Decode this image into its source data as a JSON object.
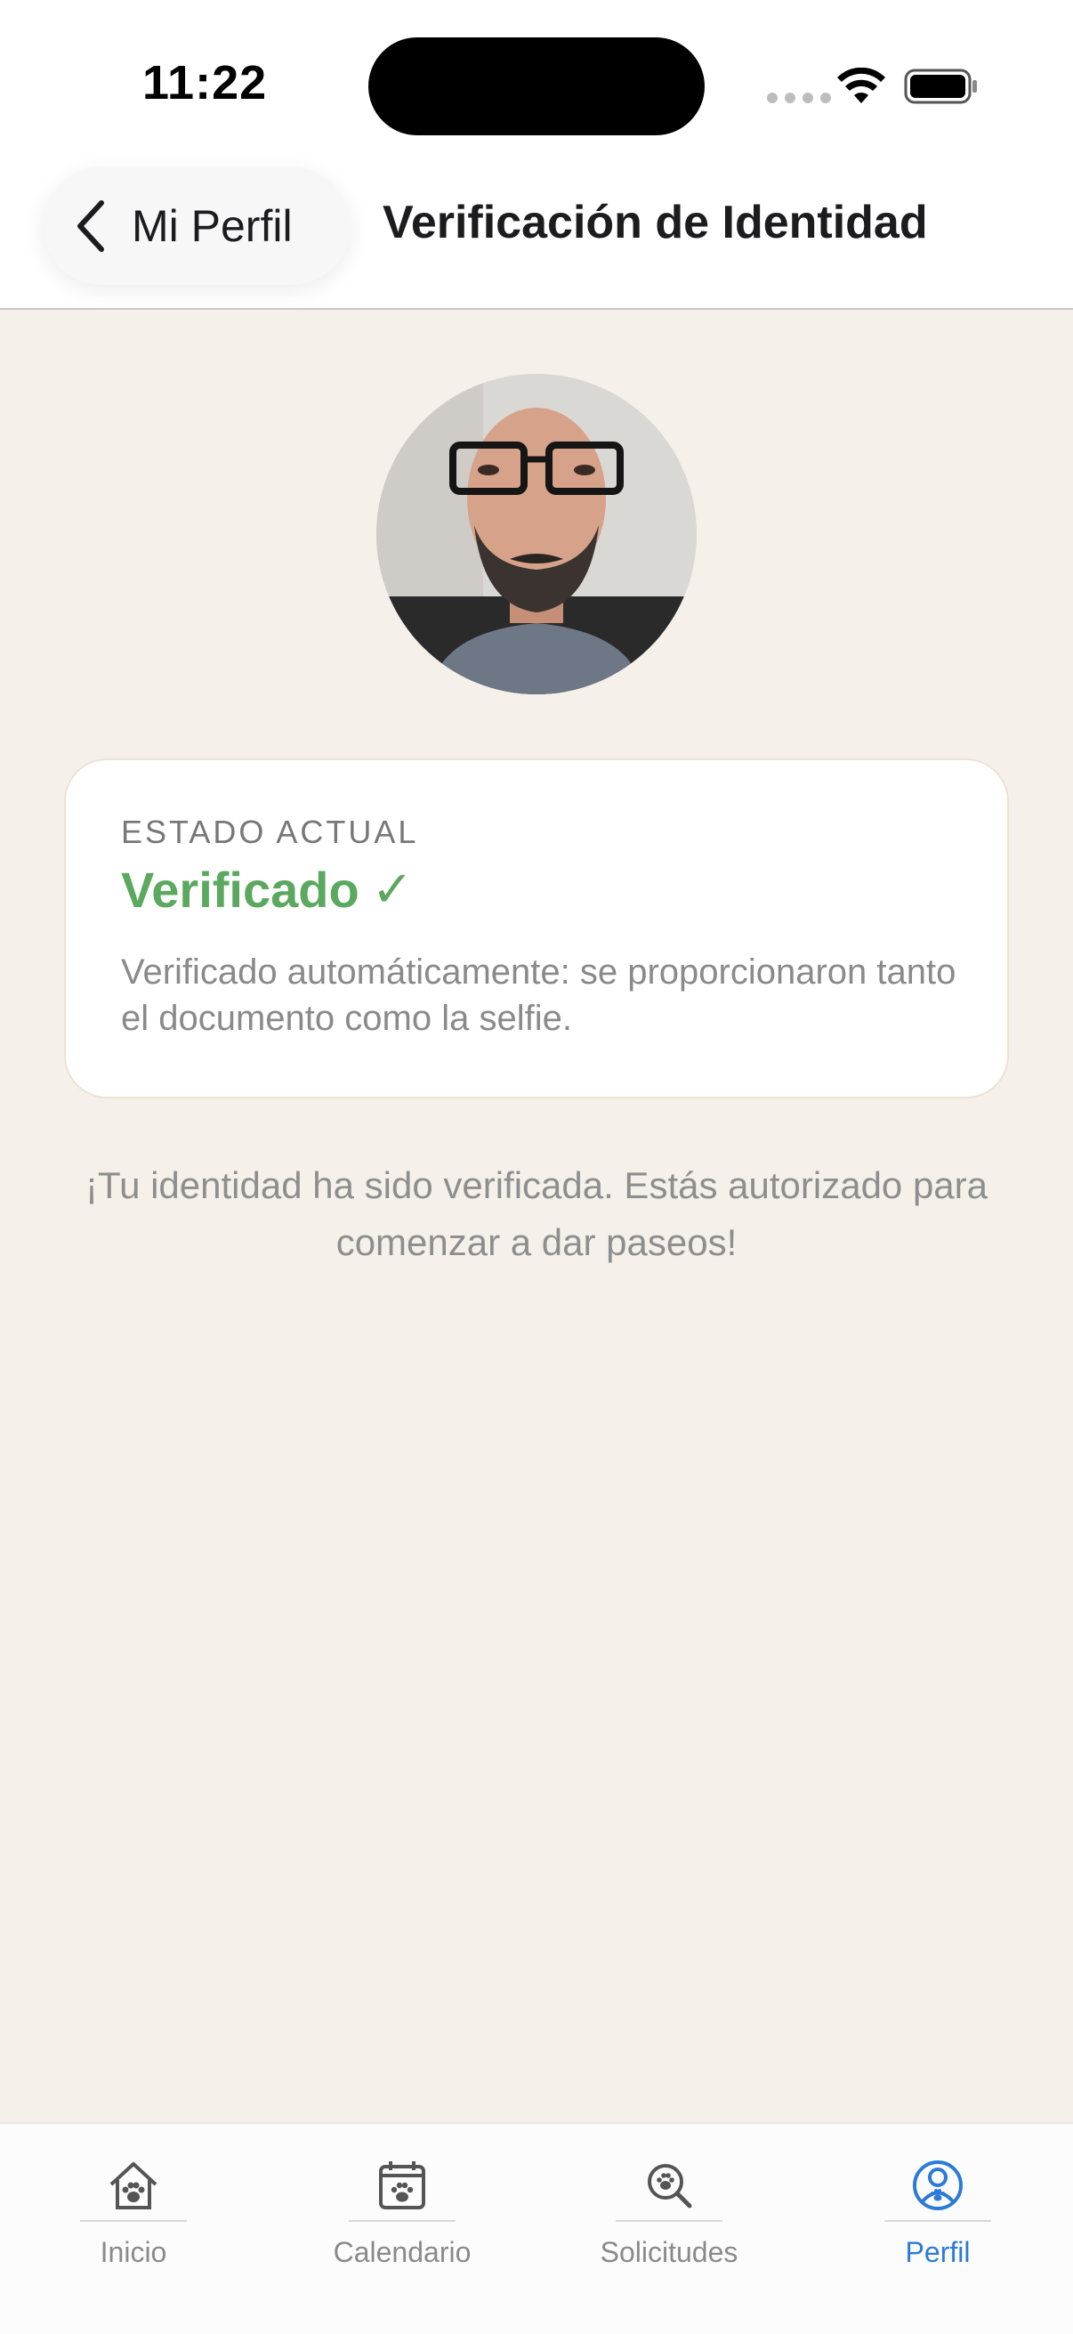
{
  "status_bar": {
    "time": "11:22"
  },
  "header": {
    "back_label": "Mi Perfil",
    "title": "Verificación de Identidad"
  },
  "card": {
    "label": "ESTADO ACTUAL",
    "status": "Verificado",
    "status_check": "✓",
    "description": "Verificado automáticamente: se proporcionaron tanto el documento como la selfie.",
    "status_color": "#5BA85F"
  },
  "message": "¡Tu identidad ha sido verificada. Estás autorizado para comenzar a dar paseos!",
  "tabs": [
    {
      "label": "Inicio",
      "icon": "home-paw-icon",
      "active": false
    },
    {
      "label": "Calendario",
      "icon": "calendar-paw-icon",
      "active": false
    },
    {
      "label": "Solicitudes",
      "icon": "search-paw-icon",
      "active": false
    },
    {
      "label": "Perfil",
      "icon": "profile-paw-icon",
      "active": true
    }
  ],
  "colors": {
    "background": "#F5F1EA",
    "accent": "#2B7BD6",
    "success": "#5BA85F"
  }
}
